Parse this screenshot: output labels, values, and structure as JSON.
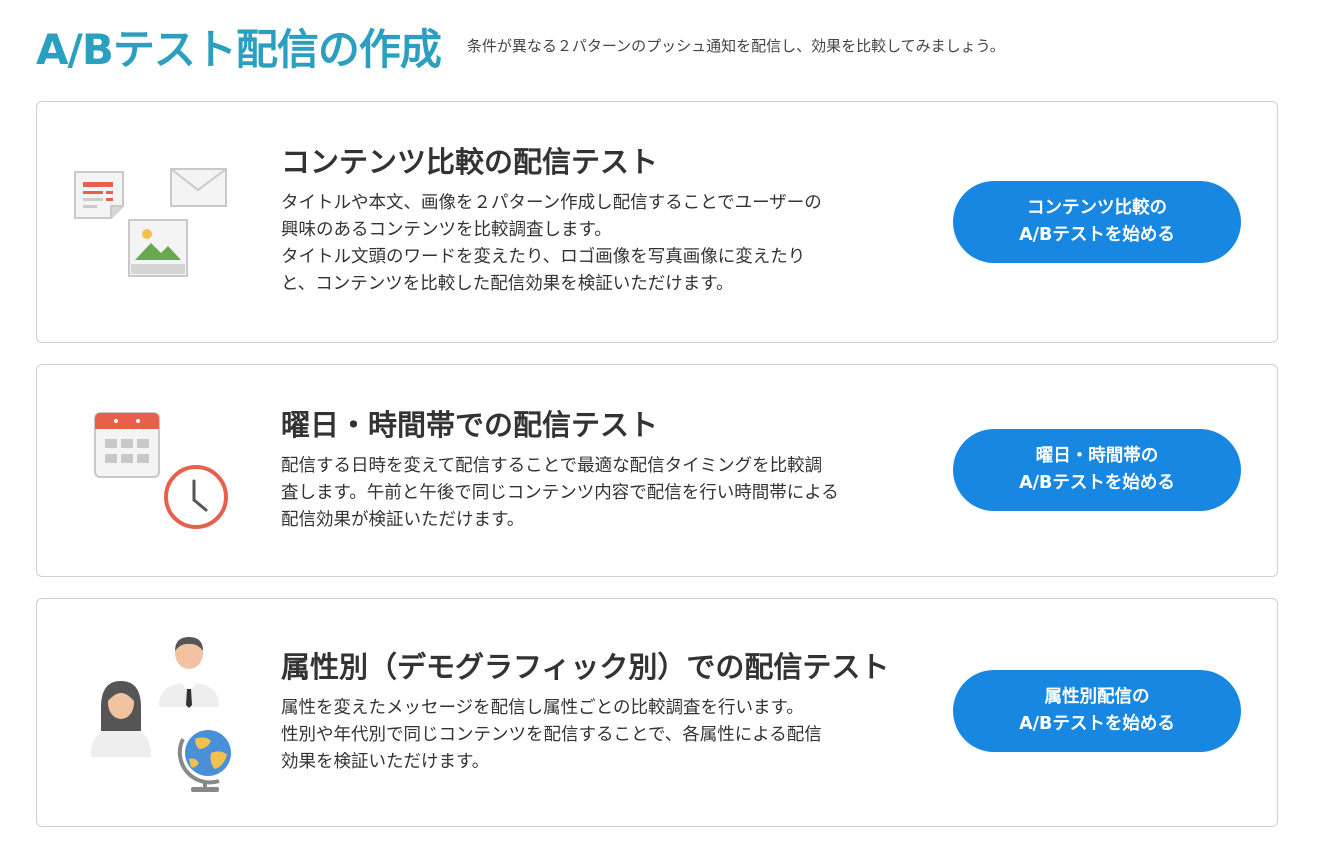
{
  "header": {
    "title": "A/Bテスト配信の作成",
    "subtitle": "条件が異なる２パターンのプッシュ通知を配信し、効果を比較してみましょう。"
  },
  "cards": [
    {
      "title": "コンテンツ比較の配信テスト",
      "description_lines": [
        "タイトルや本文、画像を２パターン作成し配信することでユーザーの",
        "興味のあるコンテンツを比較調査します。",
        "タイトル文頭のワードを変えたり、ロゴ画像を写真画像に変えたり",
        "と、コンテンツを比較した配信効果を検証いただけます。"
      ],
      "button_line1": "コンテンツ比較の",
      "button_line2": "A/Bテストを始める",
      "icon": "content-documents-icon"
    },
    {
      "title": "曜日・時間帯での配信テスト",
      "description_lines": [
        "配信する日時を変えて配信することで最適な配信タイミングを比較調",
        "査します。午前と午後で同じコンテンツ内容で配信を行い時間帯による",
        "配信効果が検証いただけます。"
      ],
      "button_line1": "曜日・時間帯の",
      "button_line2": "A/Bテストを始める",
      "icon": "calendar-clock-icon"
    },
    {
      "title": "属性別（デモグラフィック別）での配信テスト",
      "description_lines": [
        "属性を変えたメッセージを配信し属性ごとの比較調査を行います。",
        "性別や年代別で同じコンテンツを配信することで、各属性による配信",
        "効果を検証いただけます。"
      ],
      "button_line1": "属性別配信の",
      "button_line2": "A/Bテストを始める",
      "icon": "people-globe-icon"
    }
  ],
  "colors": {
    "title": "#2a9fc0",
    "button": "#1887e2",
    "border": "#cfcfcf"
  }
}
